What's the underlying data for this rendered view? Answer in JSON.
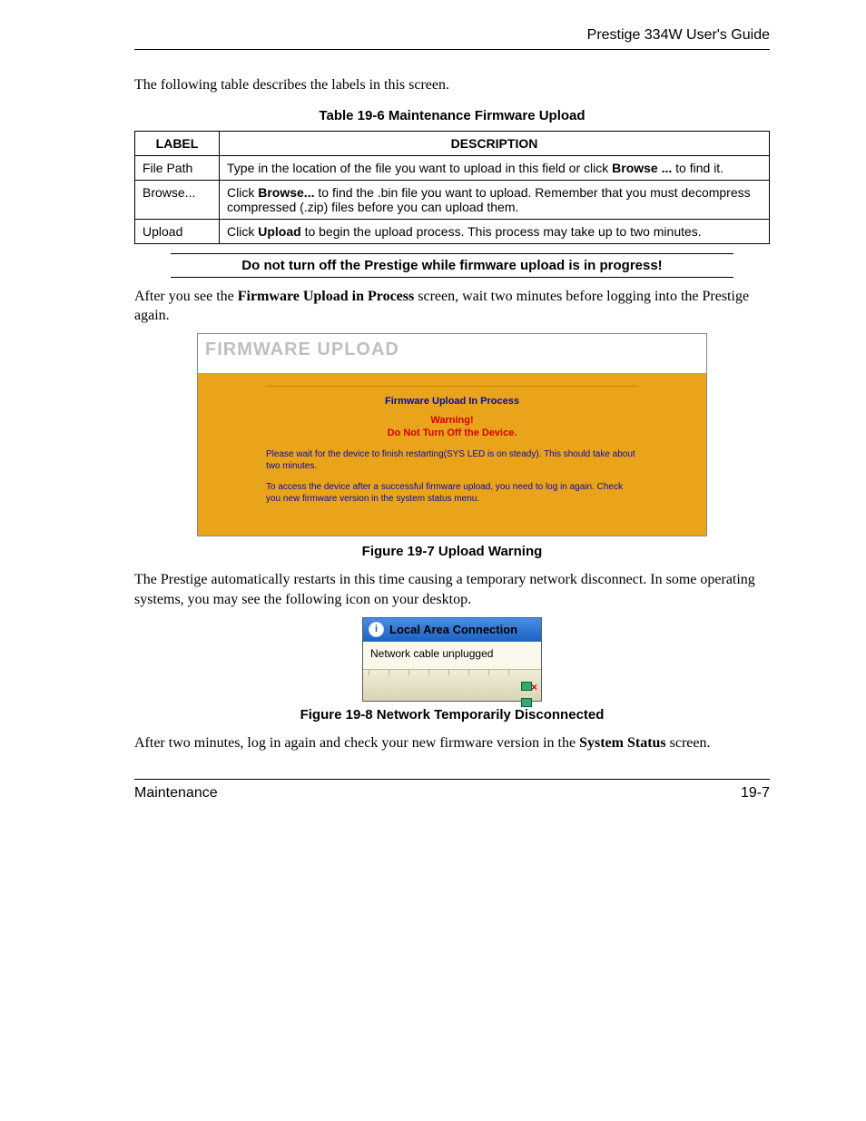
{
  "header": {
    "guide_title": "Prestige 334W User's Guide"
  },
  "intro": "The following table describes the labels in this screen.",
  "table": {
    "caption": "Table 19-6 Maintenance Firmware Upload",
    "header_label": "Label",
    "header_desc": "Description",
    "rows": [
      {
        "label": "File Path",
        "desc_pre": "Type in the location of the file you want to upload in this field or click ",
        "desc_bold": "Browse ...",
        "desc_post": " to find it."
      },
      {
        "label": "Browse...",
        "desc_pre": "Click ",
        "desc_bold": "Browse...",
        "desc_post": " to find the .bin file you want to upload. Remember that you must decompress compressed (.zip) files before you can upload them."
      },
      {
        "label": "Upload",
        "desc_pre": "Click ",
        "desc_bold": "Upload",
        "desc_post": " to begin the upload process. This process may take up to two minutes."
      }
    ]
  },
  "warning_bar": "Do not turn off the Prestige while firmware upload is in progress!",
  "para_after_table": {
    "pre": "After you see the ",
    "bold": "Firmware Upload in Process",
    "post": " screen, wait two minutes before logging into the Prestige again."
  },
  "fig7": {
    "panel_title": "FIRMWARE UPLOAD",
    "h1": "Firmware Upload In Process",
    "warn1": "Warning!",
    "warn2": "Do Not Turn Off the Device.",
    "line1": "Please wait for the device to finish restarting(SYS LED is on steady). This should take about two minutes.",
    "line2": "To access the device after a successful firmware upload, you need to log in again. Check you new firmware version in the system status menu.",
    "caption": "Figure 19-7 Upload Warning"
  },
  "para_mid": "The Prestige automatically restarts in this time causing a temporary network disconnect. In some operating systems, you may see the following icon on your desktop.",
  "fig8": {
    "title": "Local Area Connection",
    "msg": "Network cable unplugged",
    "caption": "Figure 19-8 Network Temporarily Disconnected"
  },
  "para_end": {
    "pre": "After two minutes, log in again and check your new firmware version in the ",
    "bold": "System Status",
    "post": " screen."
  },
  "footer": {
    "left": "Maintenance",
    "right": "19-7"
  }
}
